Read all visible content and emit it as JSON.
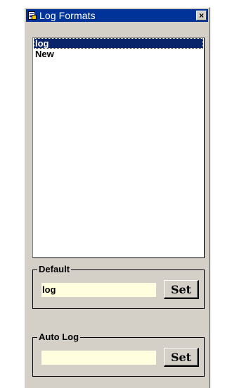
{
  "window": {
    "title": "Log Formats",
    "close_glyph": "×"
  },
  "log_list": {
    "items": [
      {
        "label": "log",
        "selected": true
      },
      {
        "label": "New",
        "selected": false
      }
    ]
  },
  "default_group": {
    "legend": "Default",
    "value": "log",
    "set_label": "Set"
  },
  "auto_log_group": {
    "legend": "Auto Log",
    "value": "",
    "set_label": "Set"
  },
  "colors": {
    "title_bar": "#003399",
    "selection": "#0a246a",
    "field_background": "#ffffe0",
    "dialog_face": "#d4d0c8"
  },
  "icons": {
    "title": "log-formats-app-icon",
    "close": "close-icon"
  }
}
